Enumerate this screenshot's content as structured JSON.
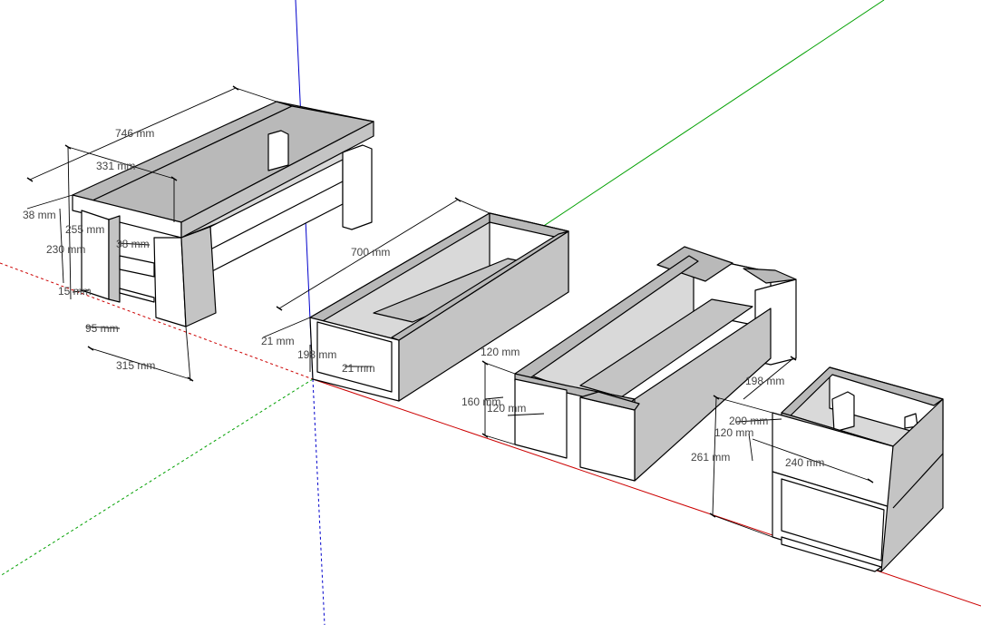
{
  "colors": {
    "background": "#ffffff",
    "face_light": "#ffffff",
    "face_top": "#b9b9b9",
    "face_shade": "#d9d9d9",
    "face_dark": "#c4c4c4",
    "axis_red": "#cc0000",
    "axis_green": "#00a000",
    "axis_blue": "#0000cc"
  },
  "dimensions": {
    "d746": "746 mm",
    "d331": "331 mm",
    "d38a": "38 mm",
    "d255": "255 mm",
    "d38b": "38 mm",
    "d230": "230 mm",
    "d15": "15 mm",
    "d95": "95 mm",
    "d315": "315 mm",
    "d700": "700 mm",
    "d21a": "21 mm",
    "d198a": "198 mm",
    "d21b": "21 mm",
    "d120a": "120 mm",
    "d160": "160 mm",
    "d120b": "120 mm",
    "d198b": "198 mm",
    "d200": "200 mm",
    "d120c": "120 mm",
    "d261": "261 mm",
    "d240": "240 mm"
  }
}
